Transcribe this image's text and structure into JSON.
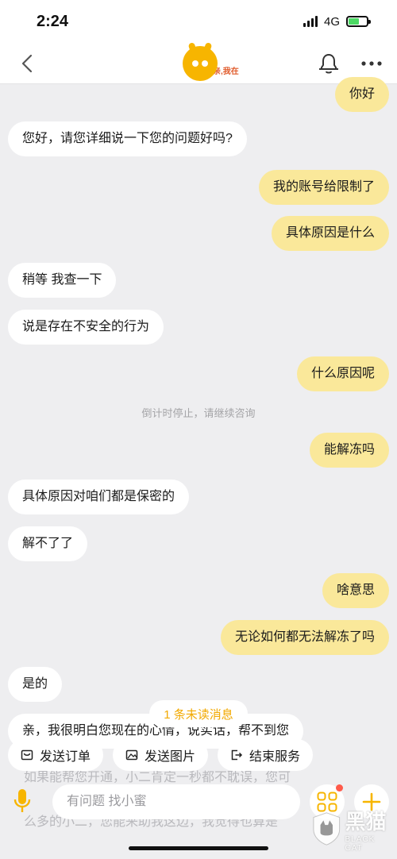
{
  "status_bar": {
    "time": "2:24",
    "network": "4G"
  },
  "nav": {
    "logo_text": "亲,我在"
  },
  "messages": [
    {
      "side": "right",
      "text": "你好"
    },
    {
      "side": "left",
      "text": "您好，请您详细说一下您的问题好吗?"
    },
    {
      "side": "right",
      "text": "我的账号给限制了"
    },
    {
      "side": "right",
      "text": "具体原因是什么"
    },
    {
      "side": "left",
      "text": "稍等 我查一下"
    },
    {
      "side": "left",
      "text": "说是存在不安全的行为"
    },
    {
      "side": "right",
      "text": "什么原因呢"
    },
    {
      "side": "right",
      "text": "能解冻吗"
    },
    {
      "side": "left",
      "text": "具体原因对咱们都是保密的"
    },
    {
      "side": "left",
      "text": "解不了了"
    },
    {
      "side": "right",
      "text": "啥意思"
    },
    {
      "side": "right",
      "text": "无论如何都无法解冻了吗"
    },
    {
      "side": "left",
      "text": "是的"
    },
    {
      "side": "left",
      "text": "亲，我很明白您现在的心情，说实话，帮不到您"
    }
  ],
  "system_note": "倒计时停止，请继续咨询",
  "faded_lines": [
    "如果能帮您开通，小二肯定一秒都不耽误，您可",
    "么多的小二，您能来助我这边，我觉得也算是"
  ],
  "unread": "1 条未读消息",
  "quick_actions": [
    {
      "label": "发送订单",
      "icon": "order-icon"
    },
    {
      "label": "发送图片",
      "icon": "image-icon"
    },
    {
      "label": "结束服务",
      "icon": "exit-icon"
    }
  ],
  "input": {
    "placeholder": "有问题 找小蜜"
  },
  "watermark": {
    "cn": "黑猫",
    "en": "BLACK CAT"
  },
  "colors": {
    "accent": "#f7b500",
    "bubble_right": "#fae89a",
    "unread_text": "#f2a900"
  }
}
